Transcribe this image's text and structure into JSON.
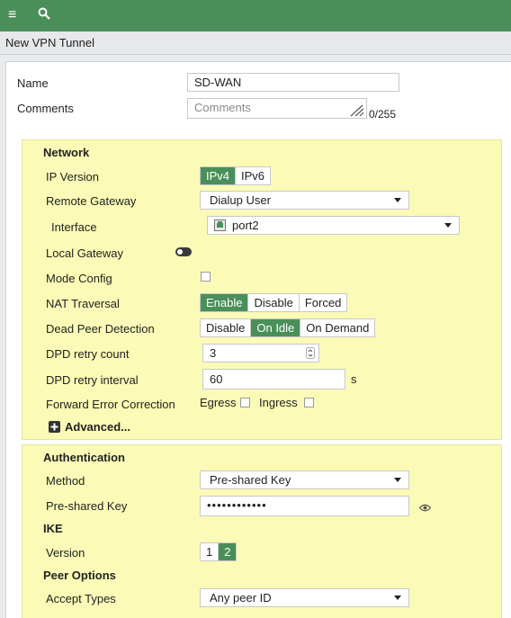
{
  "topbar": {
    "menu_icon": "≡",
    "search_icon": "⌕"
  },
  "page": {
    "title": "New VPN Tunnel"
  },
  "form": {
    "name_label": "Name",
    "name_value": "SD-WAN",
    "comments_label": "Comments",
    "comments_placeholder": "Comments",
    "comments_counter": "0/255"
  },
  "network": {
    "header": "Network",
    "ip_version": {
      "label": "IP Version",
      "options": [
        "IPv4",
        "IPv6"
      ],
      "selected": "IPv4"
    },
    "remote_gateway": {
      "label": "Remote Gateway",
      "value": "Dialup User"
    },
    "interface": {
      "label": "Interface",
      "value": "port2"
    },
    "local_gateway": {
      "label": "Local Gateway",
      "enabled": false
    },
    "mode_config": {
      "label": "Mode Config",
      "checked": false
    },
    "nat_traversal": {
      "label": "NAT Traversal",
      "options": [
        "Enable",
        "Disable",
        "Forced"
      ],
      "selected": "Enable"
    },
    "dead_peer_detection": {
      "label": "Dead Peer Detection",
      "options": [
        "Disable",
        "On Idle",
        "On Demand"
      ],
      "selected": "On Idle"
    },
    "dpd_retry_count": {
      "label": "DPD retry count",
      "value": "3"
    },
    "dpd_retry_interval": {
      "label": "DPD retry interval",
      "value": "60",
      "unit": "s"
    },
    "fec": {
      "label": "Forward Error Correction",
      "egress_label": "Egress",
      "ingress_label": "Ingress",
      "egress_checked": false,
      "ingress_checked": false
    },
    "advanced": {
      "label": "Advanced..."
    }
  },
  "authentication": {
    "header": "Authentication",
    "method": {
      "label": "Method",
      "value": "Pre-shared Key"
    },
    "psk": {
      "label": "Pre-shared Key",
      "value": "••••••••••••"
    },
    "ike_header": "IKE",
    "version": {
      "label": "Version",
      "options": [
        "1",
        "2"
      ],
      "selected": "2"
    },
    "peer_options_header": "Peer Options",
    "accept_types": {
      "label": "Accept Types",
      "value": "Any peer ID"
    }
  },
  "colors": {
    "accent": "#4a8f5a",
    "section_bg": "#fbfbb7"
  }
}
